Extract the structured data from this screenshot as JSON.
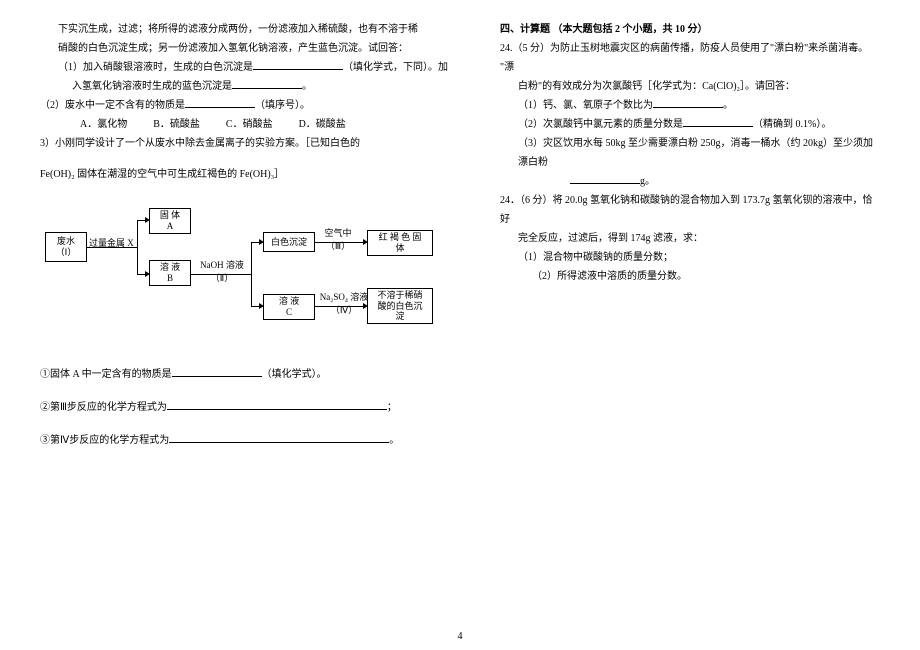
{
  "left": {
    "p1": "下实沉生成，过滤；将所得的滤液分成两份，一份滤液加入稀硫酸，也有不溶于稀",
    "p2": "硝酸的白色沉淀生成；另一份滤液加入氢氧化钠溶液，产生蓝色沉淀。试回答：",
    "q1a": "（1）加入硝酸银溶液时，生成的白色沉淀是",
    "q1b": "（填化学式，下同）。加",
    "q1c": "入氢氧化钠溶液时生成的蓝色沉淀是",
    "q1d": "。",
    "q2a": "（2）废水中一定不含有的物质是",
    "q2b": "（填序号）。",
    "choiceA": "A．氯化物",
    "choiceB": "B．硫酸盐",
    "choiceC": "C．硝酸盐",
    "choiceD": "D．碳酸盐",
    "q3": "3）小刚同学设计了一个从废水中除去金属离子的实验方案。［已知白色的",
    "note": "Fe(OH)₂ 固体在潮湿的空气中可生成红褐色的 Fe(OH)₃］",
    "flow": {
      "wastewater": "废水\n（Ⅰ）",
      "excess": "过量金属 X",
      "solidA": "固 体\nA",
      "solB": "溶 液\nB",
      "naoh": "NaOH 溶液\n（Ⅱ）",
      "whiteP": "白色沉淀",
      "solC": "溶 液\nC",
      "air": "空气中\n（Ⅲ）",
      "redSolid": "红 褐 色 固\n体",
      "na2so4": "Na₂SO₄ 溶液\n（Ⅳ）",
      "insol": "不溶于稀硝\n酸的白色沉\n淀"
    },
    "a1a": "①固体 A 中一定含有的物质是",
    "a1b": "（填化学式）。",
    "a2a": "②第Ⅲ步反应的化学方程式为",
    "a2b": "；",
    "a3a": "③第Ⅳ步反应的化学方程式为",
    "a3b": "。"
  },
  "right": {
    "title": "四、计算题 （本大题包括 2 个小题，共 10 分）",
    "q24a": "24.（5 分）为防止玉树地震灾区的病菌传播，防疫人员使用了\"漂白粉\"来杀菌消毒。 \"漂",
    "q24b": "白粉\"的有效成分为次氯酸钙［化学式为：Ca(ClO)₂］。请回答：",
    "q24_1a": "（1）钙、氯、氧原子个数比为",
    "q24_1b": "。",
    "q24_2a": "（2）次氯酸钙中氯元素的质量分数是",
    "q24_2b": "（精确到 0.1%）。",
    "q24_3": "（3）灾区饮用水每 50kg 至少需要漂白粉 250g，消毒一桶水（约 20kg）至少须加漂白粉",
    "q24_3b": "g。",
    "q25a": "24．（6 分）将 20.0g 氢氧化钠和碳酸钠的混合物加入到 173.7g 氢氧化钡的溶液中，恰好",
    "q25b": "完全反应，过滤后，得到 174g 滤液，求：",
    "q25_1": "（1）混合物中碳酸钠的质量分数；",
    "q25_2": "（2）所得滤液中溶质的质量分数。"
  },
  "pagenum": "4"
}
